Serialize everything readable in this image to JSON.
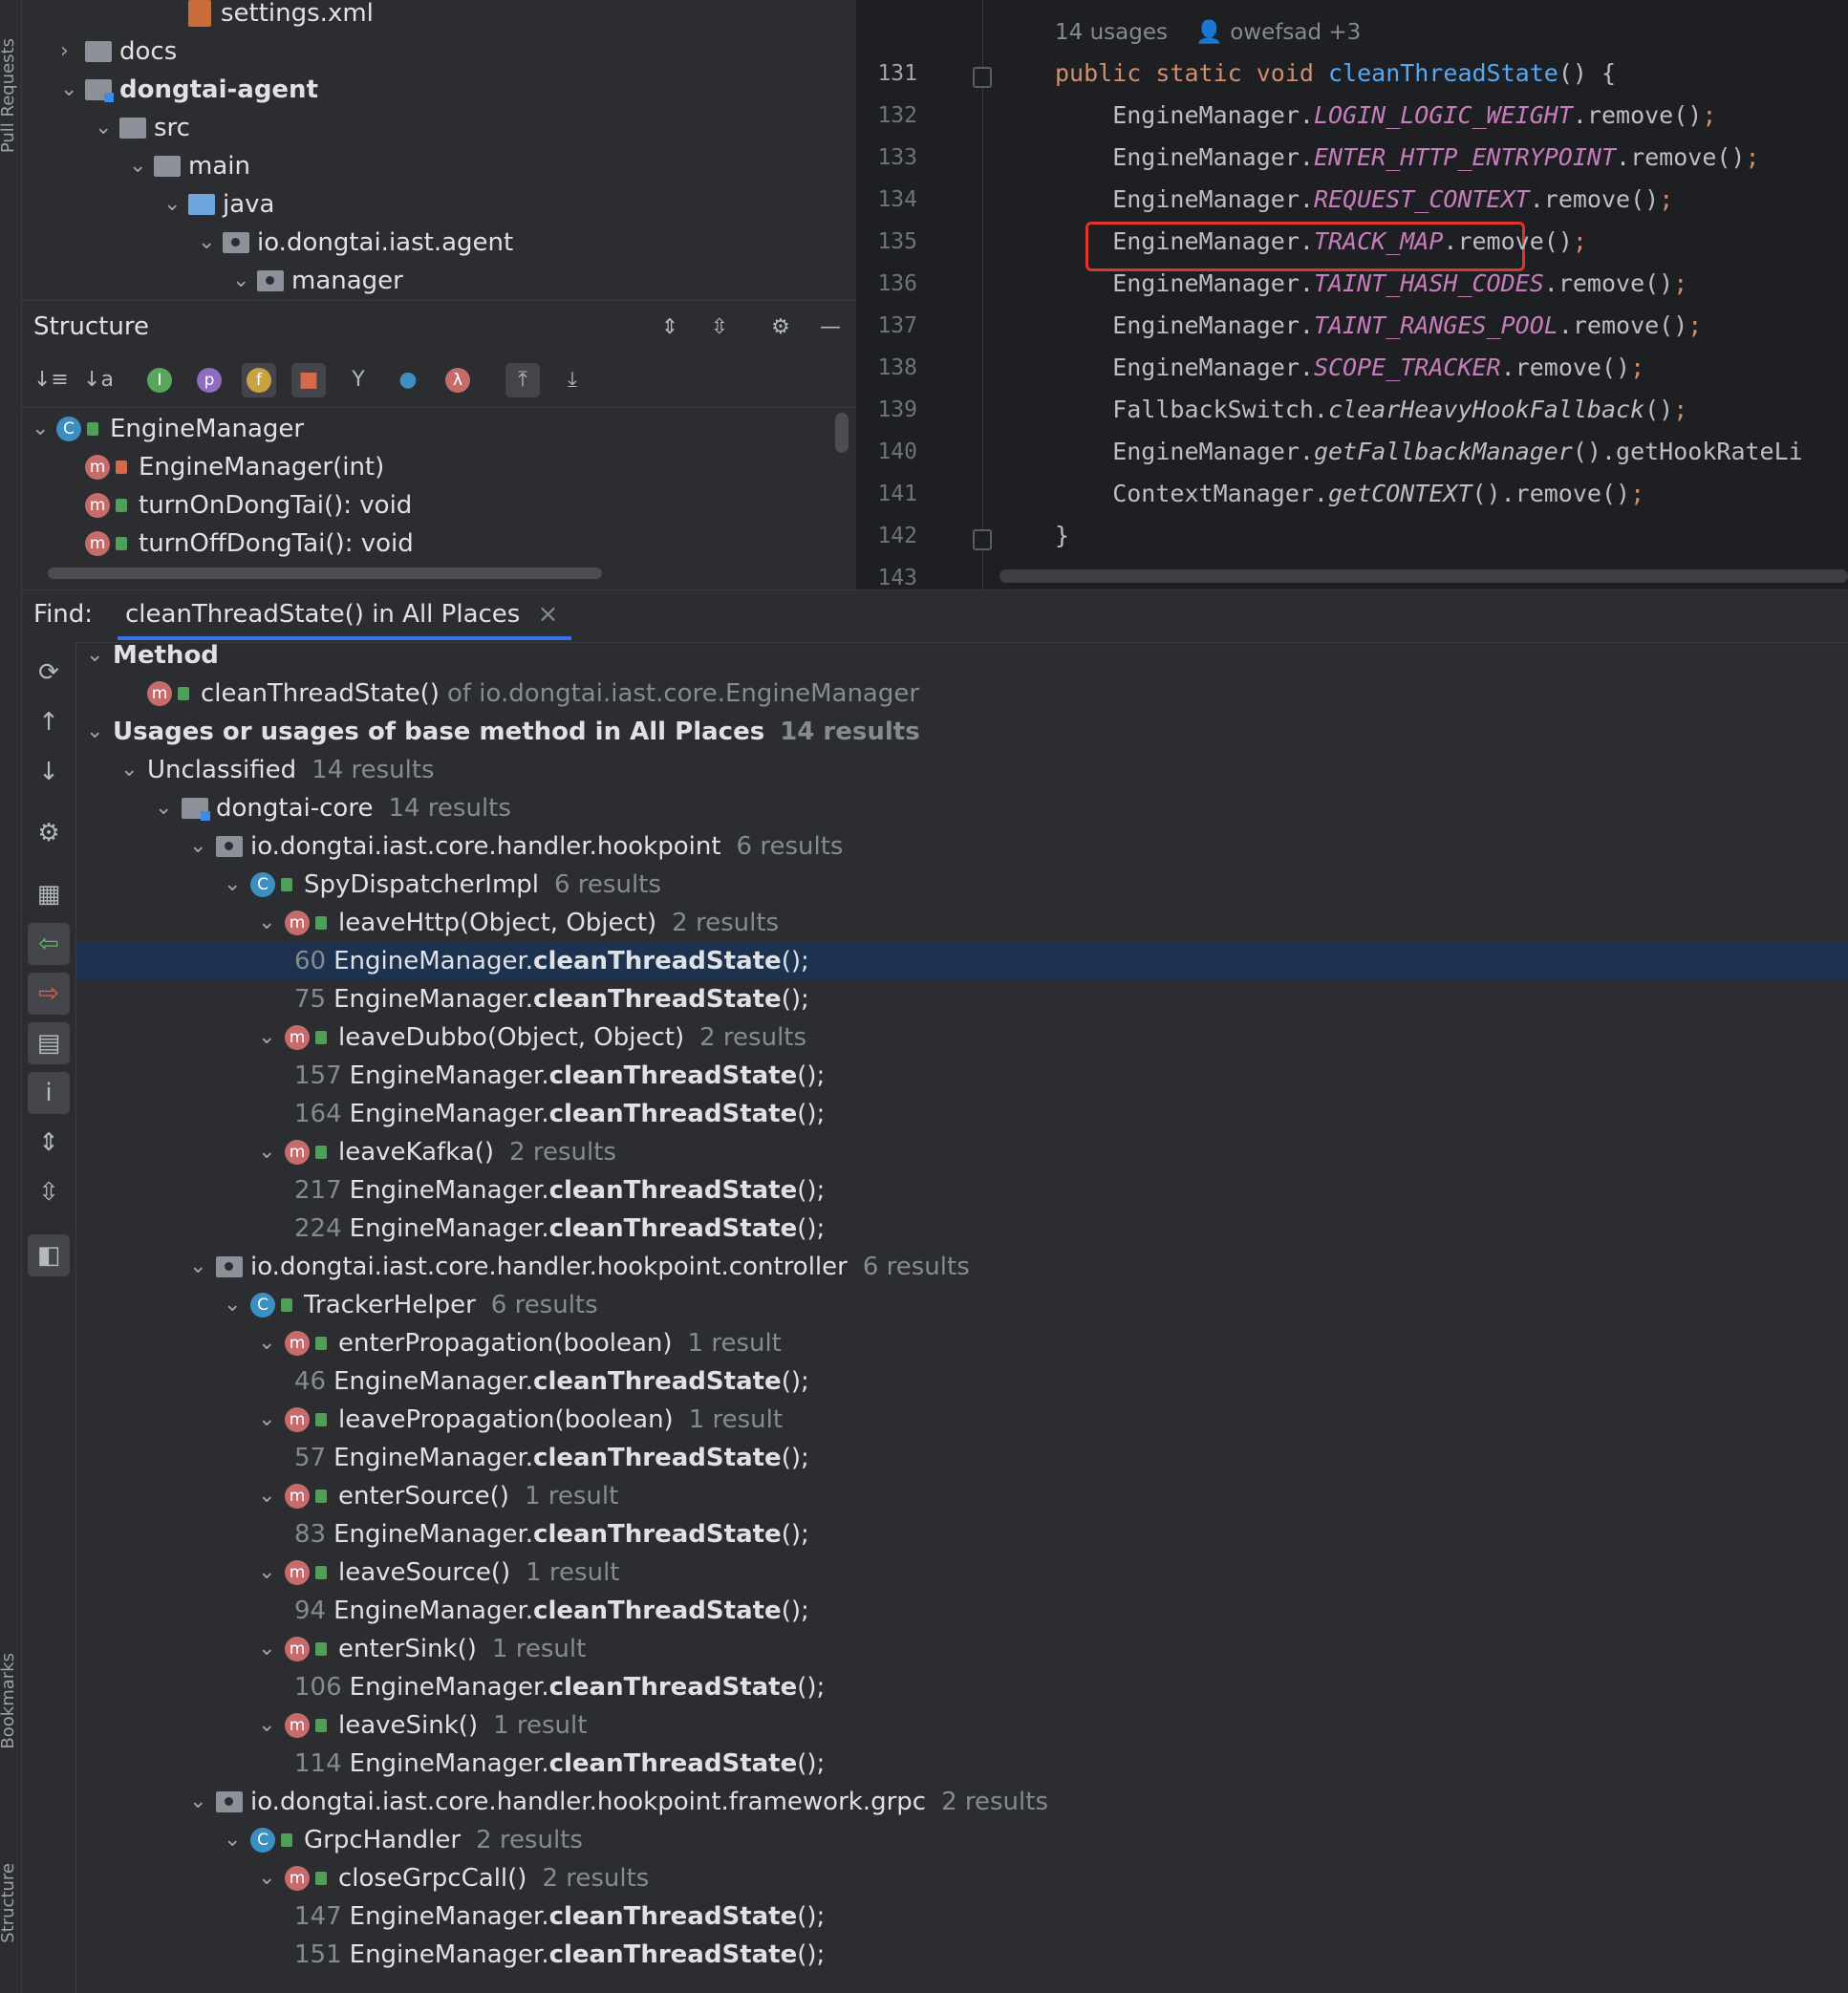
{
  "sidebar": {
    "pull_requests": "Pull Requests",
    "bookmarks": "Bookmarks",
    "structure": "Structure"
  },
  "project_tree": [
    {
      "label": "settings.xml",
      "kind": "xml",
      "indent": 4,
      "chev": ""
    },
    {
      "label": "docs",
      "kind": "folder",
      "indent": 1,
      "chev": "›"
    },
    {
      "label": "dongtai-agent",
      "kind": "module",
      "indent": 1,
      "chev": "⌄",
      "bold": true
    },
    {
      "label": "src",
      "kind": "folder",
      "indent": 2,
      "chev": "⌄"
    },
    {
      "label": "main",
      "kind": "folder",
      "indent": 3,
      "chev": "⌄"
    },
    {
      "label": "java",
      "kind": "blue",
      "indent": 4,
      "chev": "⌄"
    },
    {
      "label": "io.dongtai.iast.agent",
      "kind": "package",
      "indent": 5,
      "chev": "⌄"
    },
    {
      "label": "manager",
      "kind": "package",
      "indent": 6,
      "chev": "⌄"
    }
  ],
  "structure": {
    "title": "Structure",
    "items": [
      {
        "label": "EngineManager",
        "icon": "C",
        "indent": 0,
        "chev": "⌄",
        "access": "public"
      },
      {
        "label": "EngineManager(int)",
        "icon": "m",
        "indent": 1,
        "chev": "",
        "access": "private"
      },
      {
        "label": "turnOnDongTai(): void",
        "icon": "m",
        "indent": 1,
        "chev": "",
        "access": "public"
      },
      {
        "label": "turnOffDongTai(): void",
        "icon": "m",
        "indent": 1,
        "chev": "",
        "access": "public"
      }
    ]
  },
  "editor": {
    "hint_usages": "14 usages",
    "hint_author": "owefsad +3",
    "lines": [
      {
        "num": "131",
        "html": "<span class='kw'>public static void </span><span class='fn'>cleanThreadState</span>() {"
      },
      {
        "num": "132",
        "html": "    EngineManager.<span class='st'>LOGIN_LOGIC_WEIGHT</span>.remove()<span class='semi'>;</span>"
      },
      {
        "num": "133",
        "html": "    EngineManager.<span class='st'>ENTER_HTTP_ENTRYPOINT</span>.remove()<span class='semi'>;</span>"
      },
      {
        "num": "134",
        "html": "    EngineManager.<span class='st'>REQUEST_CONTEXT</span>.remove()<span class='semi'>;</span>"
      },
      {
        "num": "135",
        "html": "    EngineManager.<span class='st'>TRACK_MAP</span>.remove()<span class='semi'>;</span>"
      },
      {
        "num": "136",
        "html": "    EngineManager.<span class='st'>TAINT_HASH_CODES</span>.remove()<span class='semi'>;</span>"
      },
      {
        "num": "137",
        "html": "    EngineManager.<span class='st'>TAINT_RANGES_POOL</span>.remove()<span class='semi'>;</span>"
      },
      {
        "num": "138",
        "html": "    EngineManager.<span class='st'>SCOPE_TRACKER</span>.remove()<span class='semi'>;</span>"
      },
      {
        "num": "139",
        "html": "    FallbackSwitch.<span class='it'>clearHeavyHookFallback</span>()<span class='semi'>;</span>"
      },
      {
        "num": "140",
        "html": "    EngineManager.<span class='it'>getFallbackManager</span>().getHookRateLi"
      },
      {
        "num": "141",
        "html": "    ContextManager.<span class='it'>getCONTEXT</span>().remove()<span class='semi'>;</span>"
      },
      {
        "num": "142",
        "html": "}"
      },
      {
        "num": "143",
        "html": ""
      }
    ]
  },
  "find": {
    "label": "Find:",
    "tab_title": "cleanThreadState() in All Places",
    "close": "×"
  },
  "results": [
    {
      "lvl": 0,
      "type": "header",
      "text": "Method"
    },
    {
      "lvl": 1,
      "type": "method-target",
      "text": "cleanThreadState()",
      "extra": "of io.dongtai.iast.core.EngineManager"
    },
    {
      "lvl": 0,
      "type": "header",
      "text": "Usages or usages of base method in All Places",
      "count": "14 results"
    },
    {
      "lvl": 1,
      "type": "group",
      "text": "Unclassified",
      "count": "14 results"
    },
    {
      "lvl": 2,
      "type": "module",
      "text": "dongtai-core",
      "count": "14 results"
    },
    {
      "lvl": 3,
      "type": "package",
      "text": "io.dongtai.iast.core.handler.hookpoint",
      "count": "6 results"
    },
    {
      "lvl": 4,
      "type": "class",
      "text": "SpyDispatcherImpl",
      "count": "6 results"
    },
    {
      "lvl": 5,
      "type": "method",
      "text": "leaveHttp(Object, Object)",
      "count": "2 results"
    },
    {
      "lvl": 6,
      "type": "usage",
      "line": "60",
      "pre": "EngineManager.",
      "call": "cleanThreadState",
      "post": "();",
      "selected": true
    },
    {
      "lvl": 6,
      "type": "usage",
      "line": "75",
      "pre": "EngineManager.",
      "call": "cleanThreadState",
      "post": "();"
    },
    {
      "lvl": 5,
      "type": "method",
      "text": "leaveDubbo(Object, Object)",
      "count": "2 results"
    },
    {
      "lvl": 6,
      "type": "usage",
      "line": "157",
      "pre": "EngineManager.",
      "call": "cleanThreadState",
      "post": "();"
    },
    {
      "lvl": 6,
      "type": "usage",
      "line": "164",
      "pre": "EngineManager.",
      "call": "cleanThreadState",
      "post": "();"
    },
    {
      "lvl": 5,
      "type": "method",
      "text": "leaveKafka()",
      "count": "2 results"
    },
    {
      "lvl": 6,
      "type": "usage",
      "line": "217",
      "pre": "EngineManager.",
      "call": "cleanThreadState",
      "post": "();"
    },
    {
      "lvl": 6,
      "type": "usage",
      "line": "224",
      "pre": "EngineManager.",
      "call": "cleanThreadState",
      "post": "();"
    },
    {
      "lvl": 3,
      "type": "package",
      "text": "io.dongtai.iast.core.handler.hookpoint.controller",
      "count": "6 results"
    },
    {
      "lvl": 4,
      "type": "class",
      "text": "TrackerHelper",
      "count": "6 results"
    },
    {
      "lvl": 5,
      "type": "method",
      "text": "enterPropagation(boolean)",
      "count": "1 result"
    },
    {
      "lvl": 6,
      "type": "usage",
      "line": "46",
      "pre": "EngineManager.",
      "call": "cleanThreadState",
      "post": "();"
    },
    {
      "lvl": 5,
      "type": "method",
      "text": "leavePropagation(boolean)",
      "count": "1 result"
    },
    {
      "lvl": 6,
      "type": "usage",
      "line": "57",
      "pre": "EngineManager.",
      "call": "cleanThreadState",
      "post": "();"
    },
    {
      "lvl": 5,
      "type": "method",
      "text": "enterSource()",
      "count": "1 result"
    },
    {
      "lvl": 6,
      "type": "usage",
      "line": "83",
      "pre": "EngineManager.",
      "call": "cleanThreadState",
      "post": "();"
    },
    {
      "lvl": 5,
      "type": "method",
      "text": "leaveSource()",
      "count": "1 result"
    },
    {
      "lvl": 6,
      "type": "usage",
      "line": "94",
      "pre": "EngineManager.",
      "call": "cleanThreadState",
      "post": "();"
    },
    {
      "lvl": 5,
      "type": "method",
      "text": "enterSink()",
      "count": "1 result"
    },
    {
      "lvl": 6,
      "type": "usage",
      "line": "106",
      "pre": "EngineManager.",
      "call": "cleanThreadState",
      "post": "();"
    },
    {
      "lvl": 5,
      "type": "method",
      "text": "leaveSink()",
      "count": "1 result"
    },
    {
      "lvl": 6,
      "type": "usage",
      "line": "114",
      "pre": "EngineManager.",
      "call": "cleanThreadState",
      "post": "();"
    },
    {
      "lvl": 3,
      "type": "package",
      "text": "io.dongtai.iast.core.handler.hookpoint.framework.grpc",
      "count": "2 results"
    },
    {
      "lvl": 4,
      "type": "class",
      "text": "GrpcHandler",
      "count": "2 results"
    },
    {
      "lvl": 5,
      "type": "method",
      "text": "closeGrpcCall()",
      "count": "2 results"
    },
    {
      "lvl": 6,
      "type": "usage",
      "line": "147",
      "pre": "EngineManager.",
      "call": "cleanThreadState",
      "post": "();"
    },
    {
      "lvl": 6,
      "type": "usage",
      "line": "151",
      "pre": "EngineManager.",
      "call": "cleanThreadState",
      "post": "();"
    }
  ],
  "colors": {
    "selection": "#1d324f",
    "highlight_box": "#e0352b",
    "keyword": "#cf8e6d",
    "static_field": "#c77dbb",
    "function": "#56a8f5"
  }
}
